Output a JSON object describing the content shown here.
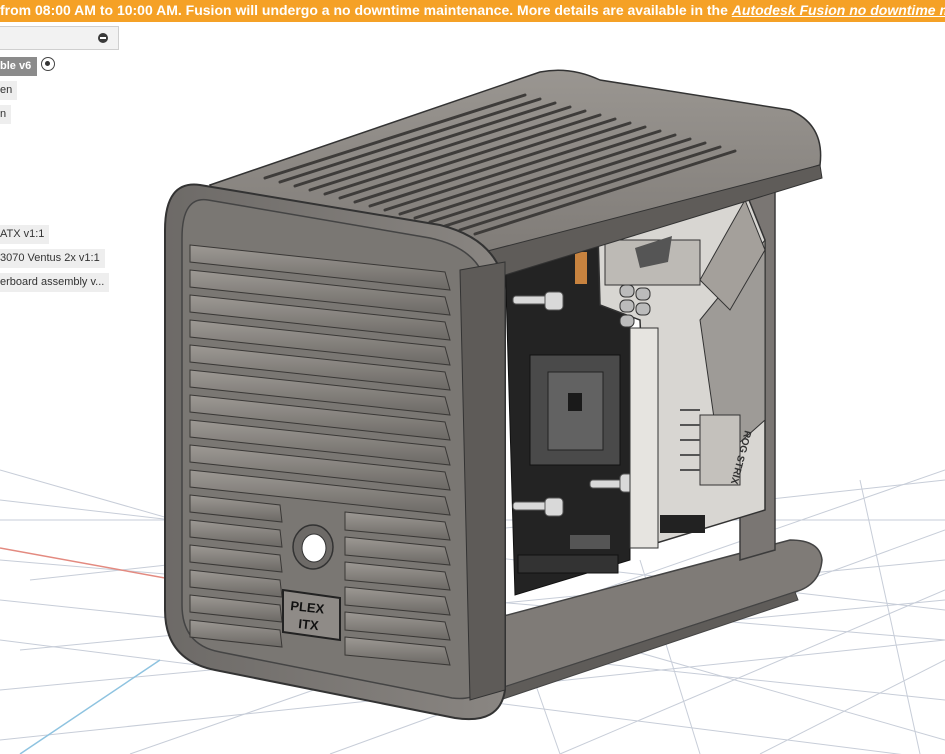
{
  "banner": {
    "message": "from 08:00 AM to 10:00 AM. Fusion will undergo a no downtime maintenance. More details are available in the ",
    "link_text": "Autodesk Fusion no downtime maintenance"
  },
  "browser": {
    "active_version": "ble v6",
    "items": [
      {
        "label": "en"
      },
      {
        "label": "n"
      },
      {
        "label": "ATX v1:1"
      },
      {
        "label": "3070 Ventus 2x v1:1"
      },
      {
        "label": "erboard assembly v..."
      }
    ]
  },
  "model": {
    "badge_line1": "PLEX",
    "badge_line2": "ITX",
    "board_text": "ROG STRIX"
  },
  "colors": {
    "banner": "#f5a126",
    "case_body": "#8c8884",
    "board": "#232323",
    "grid_line": "#c7cdd8"
  }
}
